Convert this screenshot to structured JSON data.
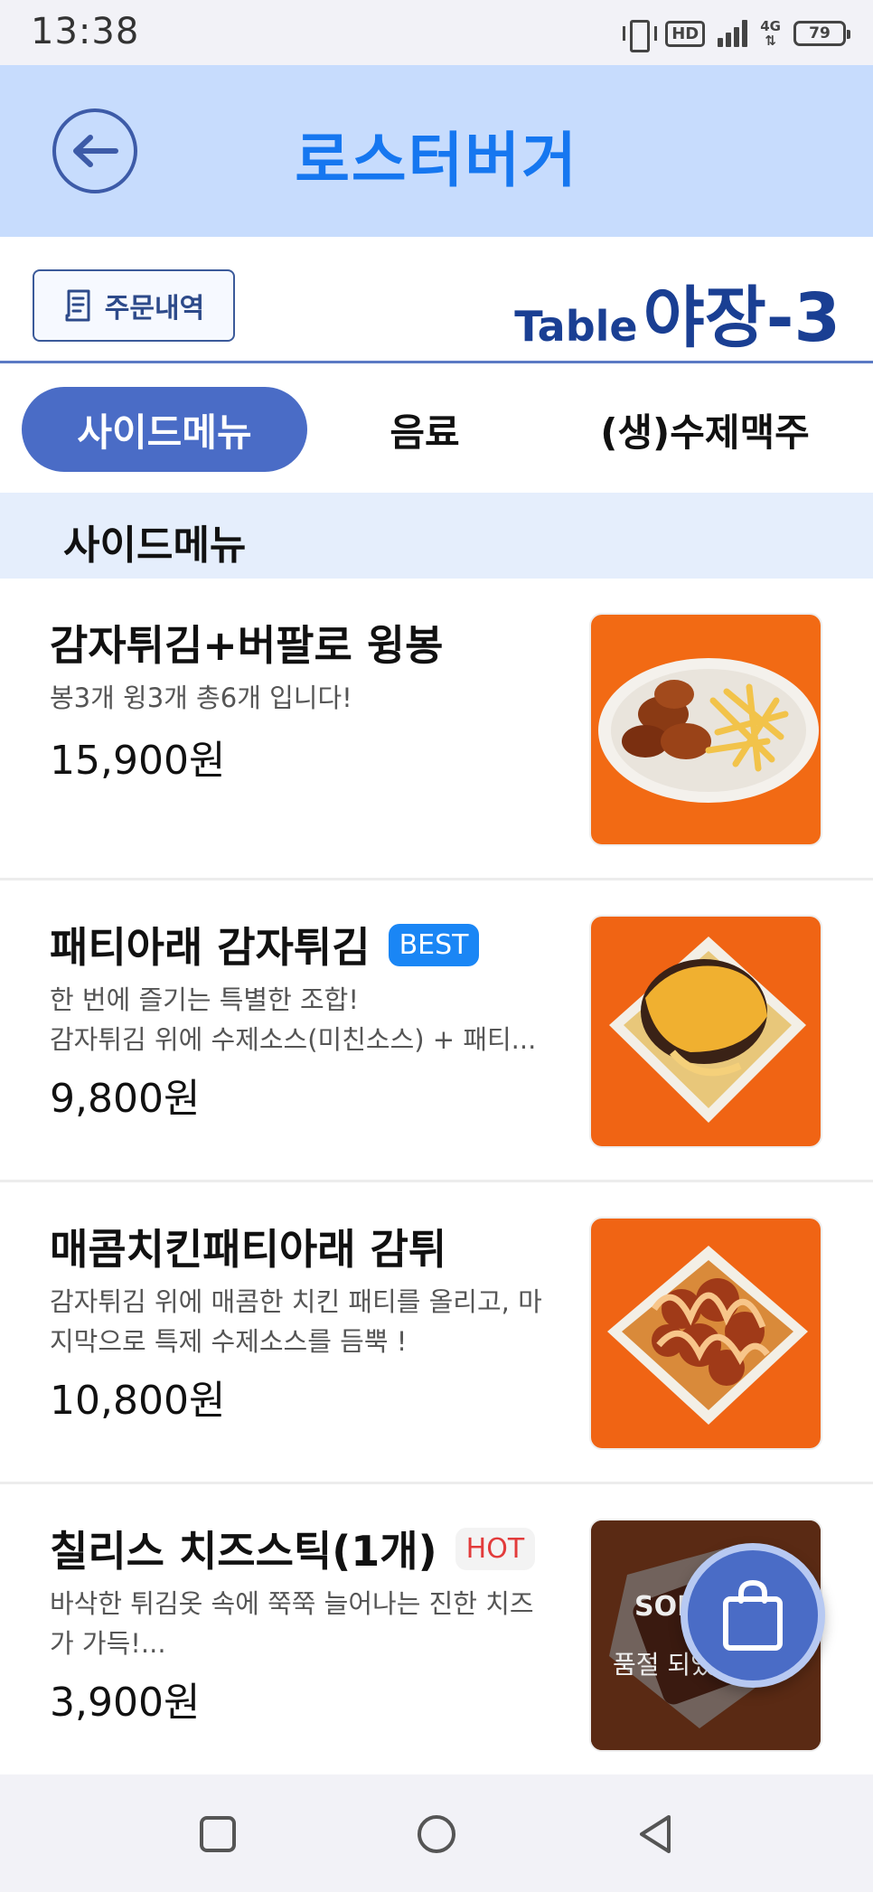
{
  "status_bar": {
    "time": "13:38",
    "hd_label": "HD",
    "network_label": "4G",
    "battery": "79",
    "icons": [
      "vibrate-icon",
      "hd-icon",
      "signal-icon",
      "network-icon",
      "battery-icon"
    ]
  },
  "header": {
    "title": "로스터버거",
    "back_icon": "arrow-left-icon",
    "accent_color": "#1677f0",
    "background": "#c7dcfd"
  },
  "order_bar": {
    "history_label": "주문내역",
    "history_icon": "receipt-icon",
    "table_word": "Table",
    "table_number": "야장-3"
  },
  "tabs": [
    {
      "label": "사이드메뉴",
      "active": true
    },
    {
      "label": "음료",
      "active": false
    },
    {
      "label": "(생)수제맥주",
      "active": false
    }
  ],
  "section": {
    "title": "사이드메뉴"
  },
  "menu_items": [
    {
      "name": "감자튀김+버팔로 윙봉",
      "badge": "",
      "desc_lines": [
        "봉3개 윙3개 총6개 입니다!"
      ],
      "price": "15,900원",
      "image": "wings-fries-image"
    },
    {
      "name": "패티아래 감자튀김",
      "badge": "BEST",
      "desc_lines": [
        "한 번에 즐기는 특별한 조합!",
        "감자튀김 위에 수제소스(미친소스) + 패티..."
      ],
      "price": "9,800원",
      "image": "patty-fries-image"
    },
    {
      "name": "매콤치킨패티아래 감튀",
      "badge": "",
      "desc_lines": [
        "감자튀김 위에 매콤한 치킨 패티를 올리고, 마",
        "지막으로 특제 수제소스를 듬뿍 !"
      ],
      "price": "10,800원",
      "image": "spicy-chicken-fries-image"
    },
    {
      "name": "칠리스 치즈스틱(1개)",
      "badge": "HOT",
      "desc_lines": [
        "바삭한 튀김옷 속에 쭉쭉 늘어나는 진한 치즈",
        "가 가득!..."
      ],
      "price": "3,900원",
      "image": "cheese-stick-image",
      "soldout_label": "SOLD",
      "soldout_sub": "품절 되었"
    }
  ],
  "cart": {
    "icon": "shopping-bag-icon"
  },
  "nav": {
    "icons": [
      "recent-apps-icon",
      "home-icon",
      "back-icon"
    ]
  }
}
